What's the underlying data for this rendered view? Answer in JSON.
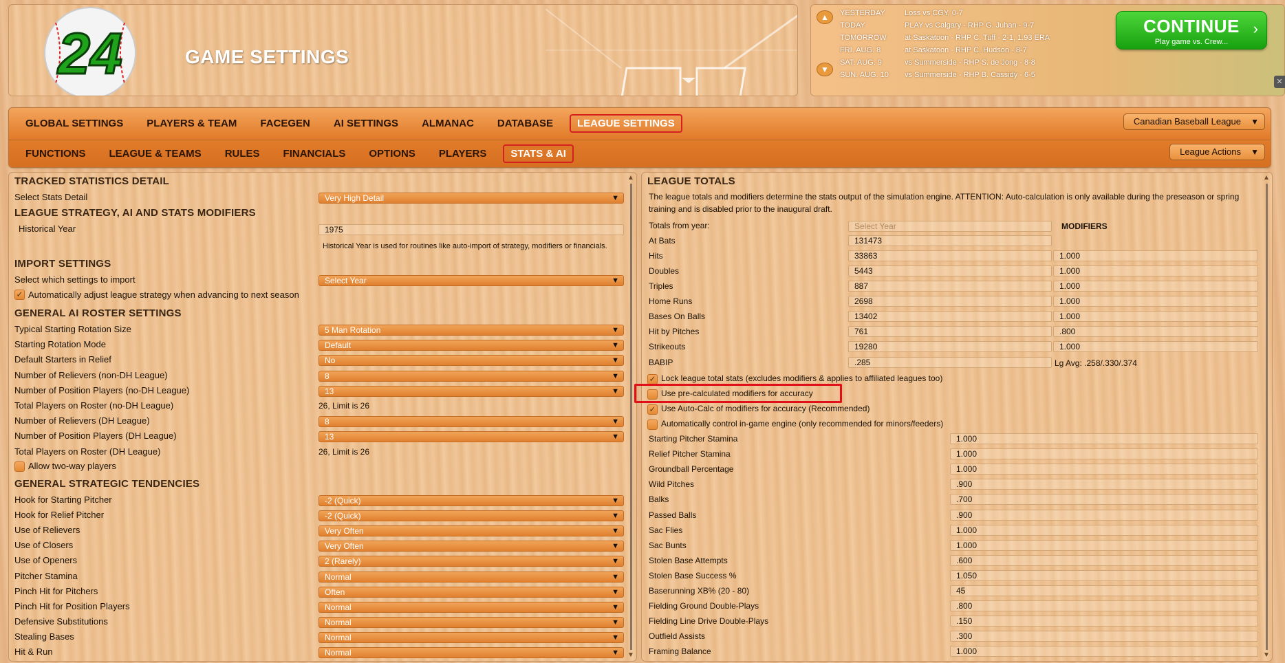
{
  "header": {
    "logo_text": "24",
    "title": "GAME SETTINGS"
  },
  "schedule": {
    "rows": [
      {
        "day": "YESTERDAY",
        "info": "Loss vs CGY, 0-7"
      },
      {
        "day": "TODAY",
        "info": "PLAY vs Calgary - RHP G. Juhan - 9-7"
      },
      {
        "day": "TOMORROW",
        "info": "at Saskatoon - RHP C. Tuff - 2-1, 1.93 ERA"
      },
      {
        "day": "FRI. AUG. 8",
        "info": "at Saskatoon - RHP C. Hudson - 8-7"
      },
      {
        "day": "SAT. AUG. 9",
        "info": "vs Summerside - RHP S. de Jong - 8-8"
      },
      {
        "day": "SUN. AUG. 10",
        "info": "vs Summerside - RHP B. Cassidy - 6-5"
      }
    ],
    "up_icon": "chevron-up-icon",
    "down_icon": "chevron-down-icon"
  },
  "continue_button": {
    "label": "CONTINUE",
    "sublabel": "Play game vs. Crew...",
    "chevron": "›",
    "color": "#2cb81f"
  },
  "close_label": "✕",
  "nav": {
    "main_tabs": [
      {
        "label": "GLOBAL SETTINGS",
        "active": false
      },
      {
        "label": "PLAYERS & TEAM",
        "active": false
      },
      {
        "label": "FACEGEN",
        "active": false
      },
      {
        "label": "AI SETTINGS",
        "active": false
      },
      {
        "label": "ALMANAC",
        "active": false
      },
      {
        "label": "DATABASE",
        "active": false
      },
      {
        "label": "LEAGUE SETTINGS",
        "active": true
      }
    ],
    "sub_tabs": [
      {
        "label": "FUNCTIONS",
        "active": false
      },
      {
        "label": "LEAGUE & TEAMS",
        "active": false
      },
      {
        "label": "RULES",
        "active": false
      },
      {
        "label": "FINANCIALS",
        "active": false
      },
      {
        "label": "OPTIONS",
        "active": false
      },
      {
        "label": "PLAYERS",
        "active": false
      },
      {
        "label": "STATS & AI",
        "active": true
      }
    ],
    "league_select": "Canadian Baseball League",
    "league_actions": "League Actions",
    "caret": "▼"
  },
  "left": {
    "sec_tracked": "TRACKED STATISTICS DETAIL",
    "stats_detail": {
      "label": "Select Stats Detail",
      "value": "Very High Detail"
    },
    "sec_strategy": "LEAGUE STRATEGY, AI AND STATS MODIFIERS",
    "historical_year": {
      "label": "Historical Year",
      "value": "1975",
      "note": "Historical Year is used for routines like auto-import of strategy, modifiers or financials."
    },
    "sec_import": "IMPORT SETTINGS",
    "import_select": {
      "label": "Select which settings to import",
      "value": "Select Year"
    },
    "auto_adjust": {
      "label": "Automatically adjust league strategy when advancing to next season",
      "checked": true
    },
    "sec_roster": "GENERAL AI ROSTER SETTINGS",
    "roster": [
      {
        "label": "Typical Starting Rotation Size",
        "value": "5 Man Rotation",
        "type": "dd"
      },
      {
        "label": "Starting Rotation Mode",
        "value": "Default",
        "type": "dd"
      },
      {
        "label": "Default Starters in Relief",
        "value": "No",
        "type": "dd"
      },
      {
        "label": "Number of Relievers (non-DH League)",
        "value": "8",
        "type": "dd"
      },
      {
        "label": "Number of Position Players (no-DH League)",
        "value": "13",
        "type": "dd"
      },
      {
        "label": "Total Players on Roster (no-DH League)",
        "value": "26, Limit is 26",
        "type": "text"
      },
      {
        "label": "Number of Relievers (DH League)",
        "value": "8",
        "type": "dd"
      },
      {
        "label": "Number of Position Players (DH League)",
        "value": "13",
        "type": "dd"
      },
      {
        "label": "Total Players on Roster (DH League)",
        "value": "26, Limit is 26",
        "type": "text"
      }
    ],
    "two_way": {
      "label": "Allow two-way players",
      "checked": false
    },
    "sec_tendencies": "GENERAL STRATEGIC TENDENCIES",
    "tendencies": [
      {
        "label": "Hook for Starting Pitcher",
        "value": "-2 (Quick)"
      },
      {
        "label": "Hook for Relief Pitcher",
        "value": "-2 (Quick)"
      },
      {
        "label": "Use of Relievers",
        "value": "Very Often"
      },
      {
        "label": "Use of Closers",
        "value": "Very Often"
      },
      {
        "label": "Use of Openers",
        "value": "2 (Rarely)"
      },
      {
        "label": "Pitcher Stamina",
        "value": "Normal"
      },
      {
        "label": "Pinch Hit for Pitchers",
        "value": "Often"
      },
      {
        "label": "Pinch Hit for Position Players",
        "value": "Normal"
      },
      {
        "label": "Defensive Substitutions",
        "value": "Normal"
      },
      {
        "label": "Stealing Bases",
        "value": "Normal"
      },
      {
        "label": "Hit & Run",
        "value": "Normal"
      }
    ]
  },
  "right": {
    "sec_totals": "LEAGUE TOTALS",
    "description": "The league totals and modifiers determine the stats output of the simulation engine. ATTENTION: Auto-calculation is only available during the preseason or spring training and is disabled prior to the inaugural draft.",
    "totals_from": {
      "label": "Totals from year:",
      "placeholder": "Select Year"
    },
    "modifiers_label": "MODIFIERS",
    "totals": [
      {
        "label": "At Bats",
        "value": "131473",
        "modifier": ""
      },
      {
        "label": "Hits",
        "value": "33863",
        "modifier": "1.000"
      },
      {
        "label": "Doubles",
        "value": "5443",
        "modifier": "1.000"
      },
      {
        "label": "Triples",
        "value": "887",
        "modifier": "1.000"
      },
      {
        "label": "Home Runs",
        "value": "2698",
        "modifier": "1.000"
      },
      {
        "label": "Bases On Balls",
        "value": "13402",
        "modifier": "1.000"
      },
      {
        "label": "Hit by Pitches",
        "value": "761",
        "modifier": ".800"
      },
      {
        "label": "Strikeouts",
        "value": "19280",
        "modifier": "1.000"
      }
    ],
    "babip": {
      "label": "BABIP",
      "value": ".285",
      "avg": "Lg Avg: .258/.330/.374"
    },
    "checks": [
      {
        "label": "Lock league total stats (excludes modifiers & applies to affiliated leagues too)",
        "checked": true
      },
      {
        "label": "Use pre-calculated modifiers for accuracy",
        "checked": false
      },
      {
        "label": "Use Auto-Calc of modifiers for accuracy (Recommended)",
        "checked": true
      },
      {
        "label": "Automatically control in-game engine (only recommended for minors/feeders)",
        "checked": false
      }
    ],
    "modifiers": [
      {
        "label": "Starting Pitcher Stamina",
        "value": "1.000"
      },
      {
        "label": "Relief Pitcher Stamina",
        "value": "1.000"
      },
      {
        "label": "Groundball Percentage",
        "value": "1.000"
      },
      {
        "label": "Wild Pitches",
        "value": ".900"
      },
      {
        "label": "Balks",
        "value": ".700"
      },
      {
        "label": "Passed Balls",
        "value": ".900"
      },
      {
        "label": "Sac Flies",
        "value": "1.000"
      },
      {
        "label": "Sac Bunts",
        "value": "1.000"
      },
      {
        "label": "Stolen Base Attempts",
        "value": ".600"
      },
      {
        "label": "Stolen Base Success %",
        "value": "1.050"
      },
      {
        "label": "Baserunning XB% (20 - 80)",
        "value": "45"
      },
      {
        "label": "Fielding Ground Double-Plays",
        "value": ".800"
      },
      {
        "label": "Fielding Line Drive Double-Plays",
        "value": ".150"
      },
      {
        "label": "Outfield Assists",
        "value": ".300"
      },
      {
        "label": "Framing Balance",
        "value": "1.000"
      }
    ]
  },
  "glyphs": {
    "check": "✓",
    "caret": "❯",
    "up": "▲",
    "down": "▼"
  },
  "colors": {
    "accent": "#e88a36",
    "highlight": "#e0101a",
    "panel_bg": "#f0c597"
  }
}
